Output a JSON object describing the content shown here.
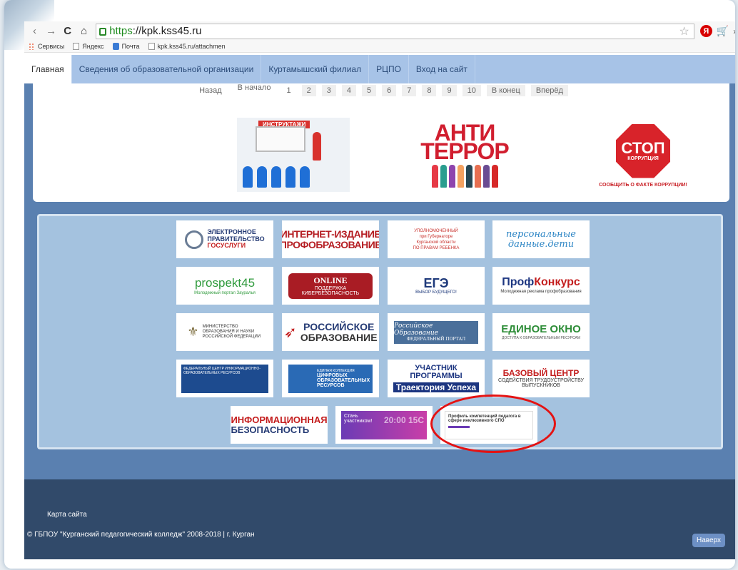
{
  "browser": {
    "back_icon": "back-arrow-icon",
    "forward_glyph": "→",
    "reload_glyph": "C",
    "home_glyph": "⌂",
    "url_scheme": "https",
    "url_rest": "://kpk.kss45.ru",
    "extensions": {
      "yandex": "Я",
      "more": "»"
    }
  },
  "bookmarks": [
    {
      "label": "Сервисы",
      "icon": "apps-icon"
    },
    {
      "label": "Яндекс",
      "icon": "page-icon"
    },
    {
      "label": "Почта",
      "icon": "mail-icon"
    },
    {
      "label": "kpk.kss45.ru/attachmen",
      "icon": "page-icon"
    }
  ],
  "nav": {
    "items": [
      "Главная",
      "Сведения об образовательной организации",
      "Куртамышский филиал",
      "РЦПО",
      "Вход на сайт"
    ],
    "active_index": 0
  },
  "pager": {
    "back": "Назад",
    "first": "В начало",
    "pages": [
      "1",
      "2",
      "3",
      "4",
      "5",
      "6",
      "7",
      "8",
      "9",
      "10"
    ],
    "last": "В конец",
    "next": "Вперёд"
  },
  "banners": {
    "instructions": "ИНСТРУКТАЖИ",
    "antiterror_line1": "АНТИ",
    "antiterror_line2": "ТЕРРОР",
    "stop_big": "СТОП",
    "stop_small": "КОРРУПЦИЯ",
    "stop_caption": "СООБЩИТЬ О ФАКТЕ КОРРУПЦИИ!"
  },
  "tiles": {
    "gov_line1": "ЭЛЕКТРОННОЕ",
    "gov_line2": "ПРАВИТЕЛЬСТВО",
    "gov_line3": "ГОСУСЛУГИ",
    "ip_line1": "ИНТЕРНЕТ-ИЗДАНИЕ",
    "ip_line2": "ПРОФОБРАЗОВАНИЕ",
    "ombud_line1": "УПОЛНОМОЧЕННЫЙ",
    "ombud_line2": "при Губернаторе",
    "ombud_line3": "Курганской области",
    "ombud_line4": "ПО ПРАВАМ РЕБЕНКА",
    "pd_line1": "персональные",
    "pd_line2": "данные.дети",
    "prosp_title": "prospekt45",
    "prosp_sub": "Молодежный портал Зауралья",
    "online_top": "ONLINE",
    "online_mid": "ПОДДЕРЖКА",
    "online_bottom": "КИБЕРБЕЗОПАСНОСТЬ",
    "ege_title": "ЕГЭ",
    "ege_sub": "ВЫБОР БУДУЩЕГО!",
    "profk_a": "Проф",
    "profk_b": "Конкурс",
    "profk_sub": "Молодежная реклама профобразования",
    "min_text": "МИНИСТЕРСТВО ОБРАЗОВАНИЯ И НАУКИ РОССИЙСКОЙ ФЕДЕРАЦИИ",
    "ros_line1": "РОССИЙСКОЕ",
    "ros_line2": "ОБРАЗОВАНИЕ",
    "fed_line1": "Российское Образование",
    "fed_line2": "ФЕДЕРАЛЬНЫЙ ПОРТАЛ",
    "eo_title": "ЕДИНОЕ ОКНО",
    "eo_sub": "ДОСТУПА К ОБРАЗОВАТЕЛЬНЫМ РЕСУРСАМ",
    "fcior_text": "ФЕДЕРАЛЬНЫЙ ЦЕНТР ИНФОРМАЦИОННО-ОБРАЗОВАТЕЛЬНЫХ РЕСУРСОВ",
    "cor_top": "ЕДИНАЯ КОЛЛЕКЦИЯ",
    "cor_line1": "ЦИФРОВЫХ",
    "cor_line2": "ОБРАЗОВАТЕЛЬНЫХ",
    "cor_line3": "РЕСУРСОВ",
    "uch_line1": "УЧАСТНИК ПРОГРАММЫ",
    "uch_line2": "Траектория Успеха",
    "baz_title": "БАЗОВЫЙ ЦЕНТР",
    "baz_sub": "СОДЕЙСТВИЯ ТРУДОУСТРОЙСТВУ ВЫПУСКНИКОВ",
    "ib_line1": "ИНФОРМАЦИОННАЯ",
    "ib_line2": "БЕЗОПАСНОСТЬ",
    "vseros_line1": "Стань",
    "vseros_line2": "участником!",
    "vseros_num": "20:00 15С",
    "prof_c_text": "Профиль компетенций педагога в сфере инклюзивного СПО"
  },
  "footer": {
    "sitemap": "Карта сайта",
    "copyright": "© ГБПОУ \"Курганский педагогический колледж\" 2008-2018 | г. Курган",
    "to_top": "Наверх"
  },
  "colors": {
    "nav_bg": "#a7c3e7",
    "page_bg": "#5a80b0",
    "footer_bg": "#314a6a",
    "highlight_ring": "#e41212"
  }
}
